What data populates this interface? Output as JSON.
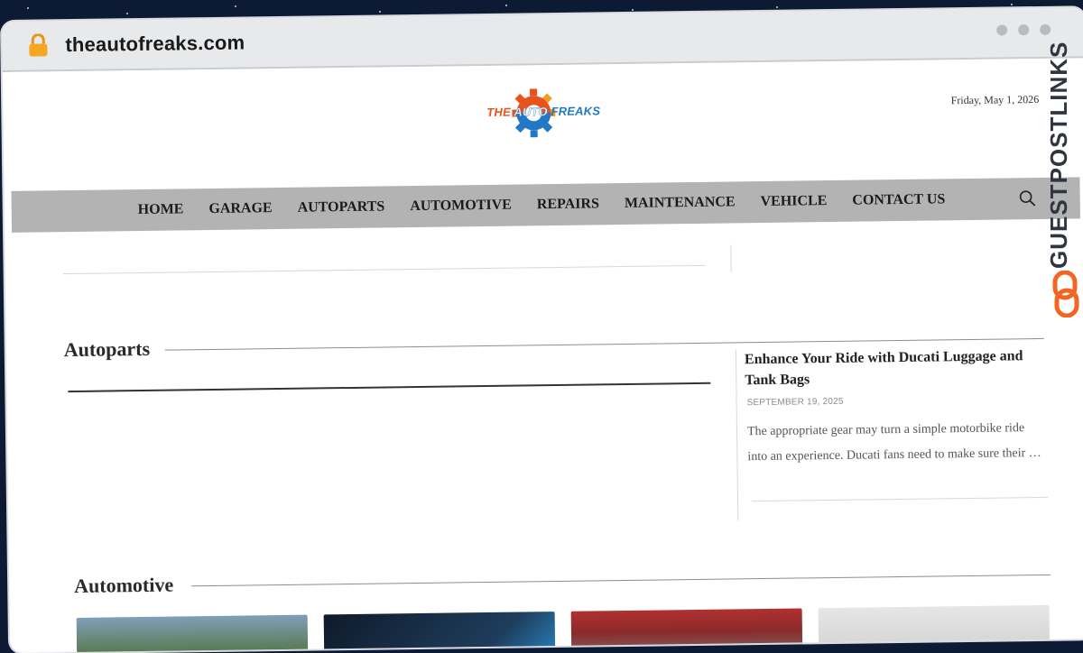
{
  "browser": {
    "url": "theautofreaks.com",
    "icons": {
      "lock": "lock-icon"
    },
    "lock_color": "#f5a623"
  },
  "header": {
    "logo": {
      "word1": "THE",
      "word2": "AUTO",
      "word3": "FREAKS"
    },
    "date": "Friday, May 1, 2026"
  },
  "nav": {
    "background": "#b3b3b3",
    "items": [
      {
        "label": "HOME"
      },
      {
        "label": "GARAGE"
      },
      {
        "label": "AUTOPARTS"
      },
      {
        "label": "AUTOMOTIVE"
      },
      {
        "label": "REPAIRS"
      },
      {
        "label": "MAINTENANCE"
      },
      {
        "label": "VEHICLE"
      },
      {
        "label": "CONTACT US"
      }
    ],
    "search_icon": "search-icon"
  },
  "sections": {
    "autoparts": {
      "title": "Autoparts"
    },
    "automotive": {
      "title": "Automotive"
    }
  },
  "sidebar_post": {
    "title": "Enhance Your Ride with Ducati Luggage and Tank Bags",
    "date": "SEPTEMBER 19, 2025",
    "excerpt": "The appropriate gear may turn a simple motorbike ride into an experience. Ducati fans need to make sure their …"
  },
  "watermark": {
    "text": "GUESTPOSTLINKS",
    "icon": "chain-link-icon",
    "accent": "#f26522"
  }
}
